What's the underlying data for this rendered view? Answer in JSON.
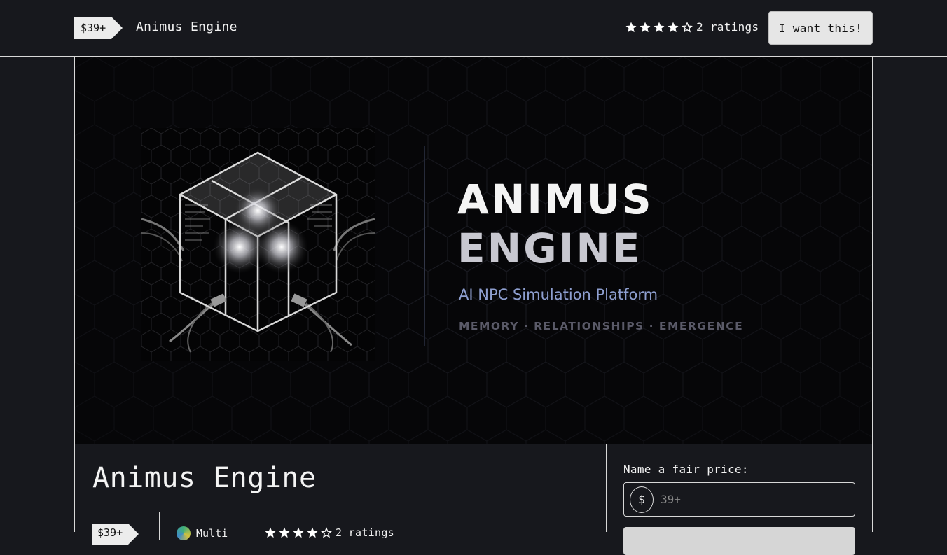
{
  "header": {
    "price_tag": "$39+",
    "product_name": "Animus Engine",
    "stars_filled": 4,
    "stars_total": 5,
    "ratings_text": "2 ratings",
    "cta_label": "I want this!"
  },
  "cover": {
    "title_line_1": "ANIMUS",
    "title_line_2": "ENGINE",
    "subtitle": "AI NPC Simulation Platform",
    "tags": "MEMORY · RELATIONSHIPS · EMERGENCE"
  },
  "product": {
    "title": "Animus Engine",
    "price_tag": "$39+",
    "creator_name": "Multi",
    "ratings_text": "2 ratings"
  },
  "purchase": {
    "price_label": "Name a fair price:",
    "currency_symbol": "$",
    "price_placeholder": "39+"
  },
  "colors": {
    "background": "#17181d",
    "border": "#d8d8d8",
    "cover_bg": "#060608",
    "subtitle_blue": "#8e9fd0",
    "button_bg": "#e6e6e6"
  }
}
